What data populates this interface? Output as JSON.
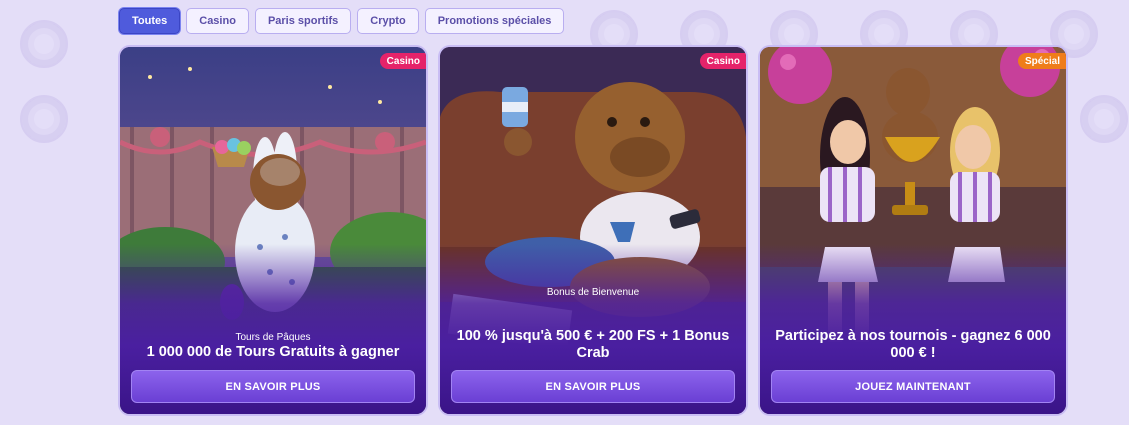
{
  "tabs": [
    {
      "label": "Toutes",
      "active": true
    },
    {
      "label": "Casino",
      "active": false
    },
    {
      "label": "Paris sportifs",
      "active": false
    },
    {
      "label": "Crypto",
      "active": false
    },
    {
      "label": "Promotions spéciales",
      "active": false
    }
  ],
  "cards": [
    {
      "badge": "Casino",
      "subtitle": "Tours de Pâques",
      "title": "1 000 000 de Tours Gratuits à gagner",
      "cta": "EN SAVOIR PLUS"
    },
    {
      "badge": "Casino",
      "subtitle": "Bonus de Bienvenue",
      "title": "100 % jusqu'à 500 € + 200 FS + 1 Bonus Crab",
      "cta": "EN SAVOIR PLUS"
    },
    {
      "badge": "Spécial",
      "subtitle": "",
      "title": "Participez à nos tournois - gagnez 6 000 000 € !",
      "cta": "JOUEZ MAINTENANT"
    }
  ],
  "colors": {
    "background": "#e4def8",
    "tab_active": "#4f5bdc",
    "badge_casino": "#e5236a",
    "badge_special": "#ef7d1a",
    "cta": "#7a4fe0"
  }
}
